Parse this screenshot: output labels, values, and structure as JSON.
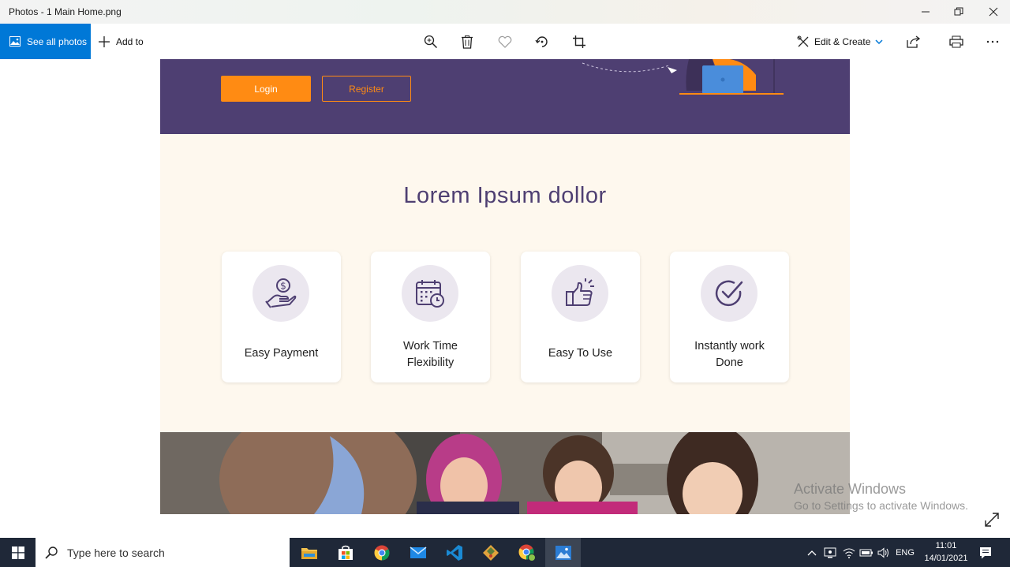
{
  "window": {
    "title": "Photos - 1 Main Home.png"
  },
  "toolbar": {
    "see_all_photos": "See all photos",
    "add_to": "Add to",
    "edit_create": "Edit & Create",
    "tools": [
      "zoom-icon",
      "delete-icon",
      "heart-icon",
      "rotate-icon",
      "crop-icon"
    ],
    "right_tools": [
      "share-icon",
      "print-icon",
      "more-icon"
    ]
  },
  "page": {
    "hero": {
      "login": "Login",
      "register": "Register"
    },
    "section_title": "Lorem Ipsum dollor",
    "features": [
      {
        "icon": "payment-hand-icon",
        "line1": "Easy Payment",
        "line2": ""
      },
      {
        "icon": "calendar-clock-icon",
        "line1": "Work Time",
        "line2": "Flexibility"
      },
      {
        "icon": "thumbs-up-icon",
        "line1": "Easy To Use",
        "line2": ""
      },
      {
        "icon": "check-circle-icon",
        "line1": "Instantly work",
        "line2": "Done"
      }
    ]
  },
  "watermark": {
    "line1": "Activate Windows",
    "line2": "Go to Settings to activate Windows."
  },
  "taskbar": {
    "search_placeholder": "Type here to search",
    "language": "ENG",
    "time": "11:01",
    "date": "14/01/2021"
  },
  "colors": {
    "accent": "#0078d7",
    "brand_purple": "#4e3f72",
    "brand_orange": "#ff8b13",
    "section_bg": "#fef8ee"
  }
}
